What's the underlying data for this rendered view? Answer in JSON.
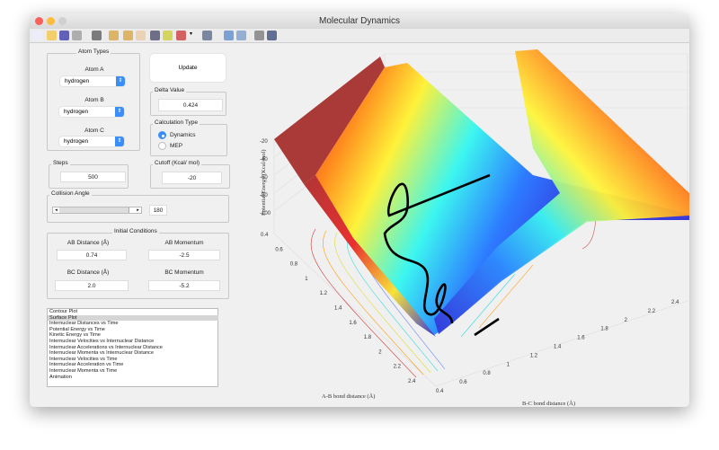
{
  "window": {
    "title": "Molecular Dynamics"
  },
  "toolbar": {
    "icons": [
      "new-file-icon",
      "open-folder-icon",
      "save-icon",
      "print-icon",
      "pointer-icon",
      "zoom-in-icon",
      "zoom-out-icon",
      "pan-hand-icon",
      "rotate-3d-icon",
      "data-cursor-icon",
      "brush-icon",
      "dropdown-arrow-icon",
      "link-plot-icon",
      "colorbar-icon",
      "legend-icon",
      "hide-plot-tools-icon",
      "show-plot-tools-icon"
    ]
  },
  "atom_types": {
    "title": "Atom Types",
    "atom_a_label": "Atom A",
    "atom_a": "hydrogen",
    "atom_b_label": "Atom B",
    "atom_b": "hydrogen",
    "atom_c_label": "Atom C",
    "atom_c": "hydrogen"
  },
  "update_label": "Update",
  "delta": {
    "title": "Delta Value",
    "value": "0.424"
  },
  "calc_type": {
    "title": "Calculation Type",
    "options": [
      "Dynamics",
      "MEP"
    ],
    "selected": "Dynamics"
  },
  "steps": {
    "title": "Steps",
    "value": "500"
  },
  "cutoff": {
    "title": "Cutoff (Kcal/ mol)",
    "value": "-20"
  },
  "collision": {
    "title": "Collision Angle",
    "value": "180",
    "slider_fraction": 1.0
  },
  "initial": {
    "title": "Initial Conditions",
    "ab_dist_label": "AB Distance (Å)",
    "ab_dist": "0.74",
    "ab_mom_label": "AB Momentum",
    "ab_mom": "-2.5",
    "bc_dist_label": "BC Distance (Å)",
    "bc_dist": "2.0",
    "bc_mom_label": "BC Momentum",
    "bc_mom": "-5.2"
  },
  "plot_list": {
    "items": [
      "Contour Plot",
      "Surface Plot",
      "Internuclear Distances vs Time",
      "Potential Energy vs Time",
      "Kinetic Energy vs Time",
      "Internuclear Velocities vs Internuclear Distance",
      "Internuclear Accelerations vs Internuclear Distance",
      "Internuclear Momenta vs Internuclear Distance",
      "Internuclear Velocities vs Time",
      "Internuclear Acceleration vs Time",
      "Internuclear Momenta vs Time",
      "Animation"
    ],
    "selected": "Surface Plot"
  },
  "plot": {
    "type": "surface",
    "zlabel": "Potential Energy (Kcal/mol)",
    "xlabel": "A-B bond distance (Å)",
    "ylabel": "B-C bond distance (Å)",
    "zticks": [
      "-20",
      "-40",
      "-60",
      "-80",
      "-100"
    ],
    "xticks": [
      "0.4",
      "0.6",
      "0.8",
      "1",
      "1.2",
      "1.4",
      "1.6",
      "1.8",
      "2",
      "2.2",
      "2.4"
    ],
    "yticks": [
      "0.4",
      "0.6",
      "0.8",
      "1",
      "1.2",
      "1.4",
      "1.6",
      "1.8",
      "2",
      "2.2",
      "2.4"
    ],
    "colormap": "jet",
    "trajectory_color": "#000000"
  }
}
